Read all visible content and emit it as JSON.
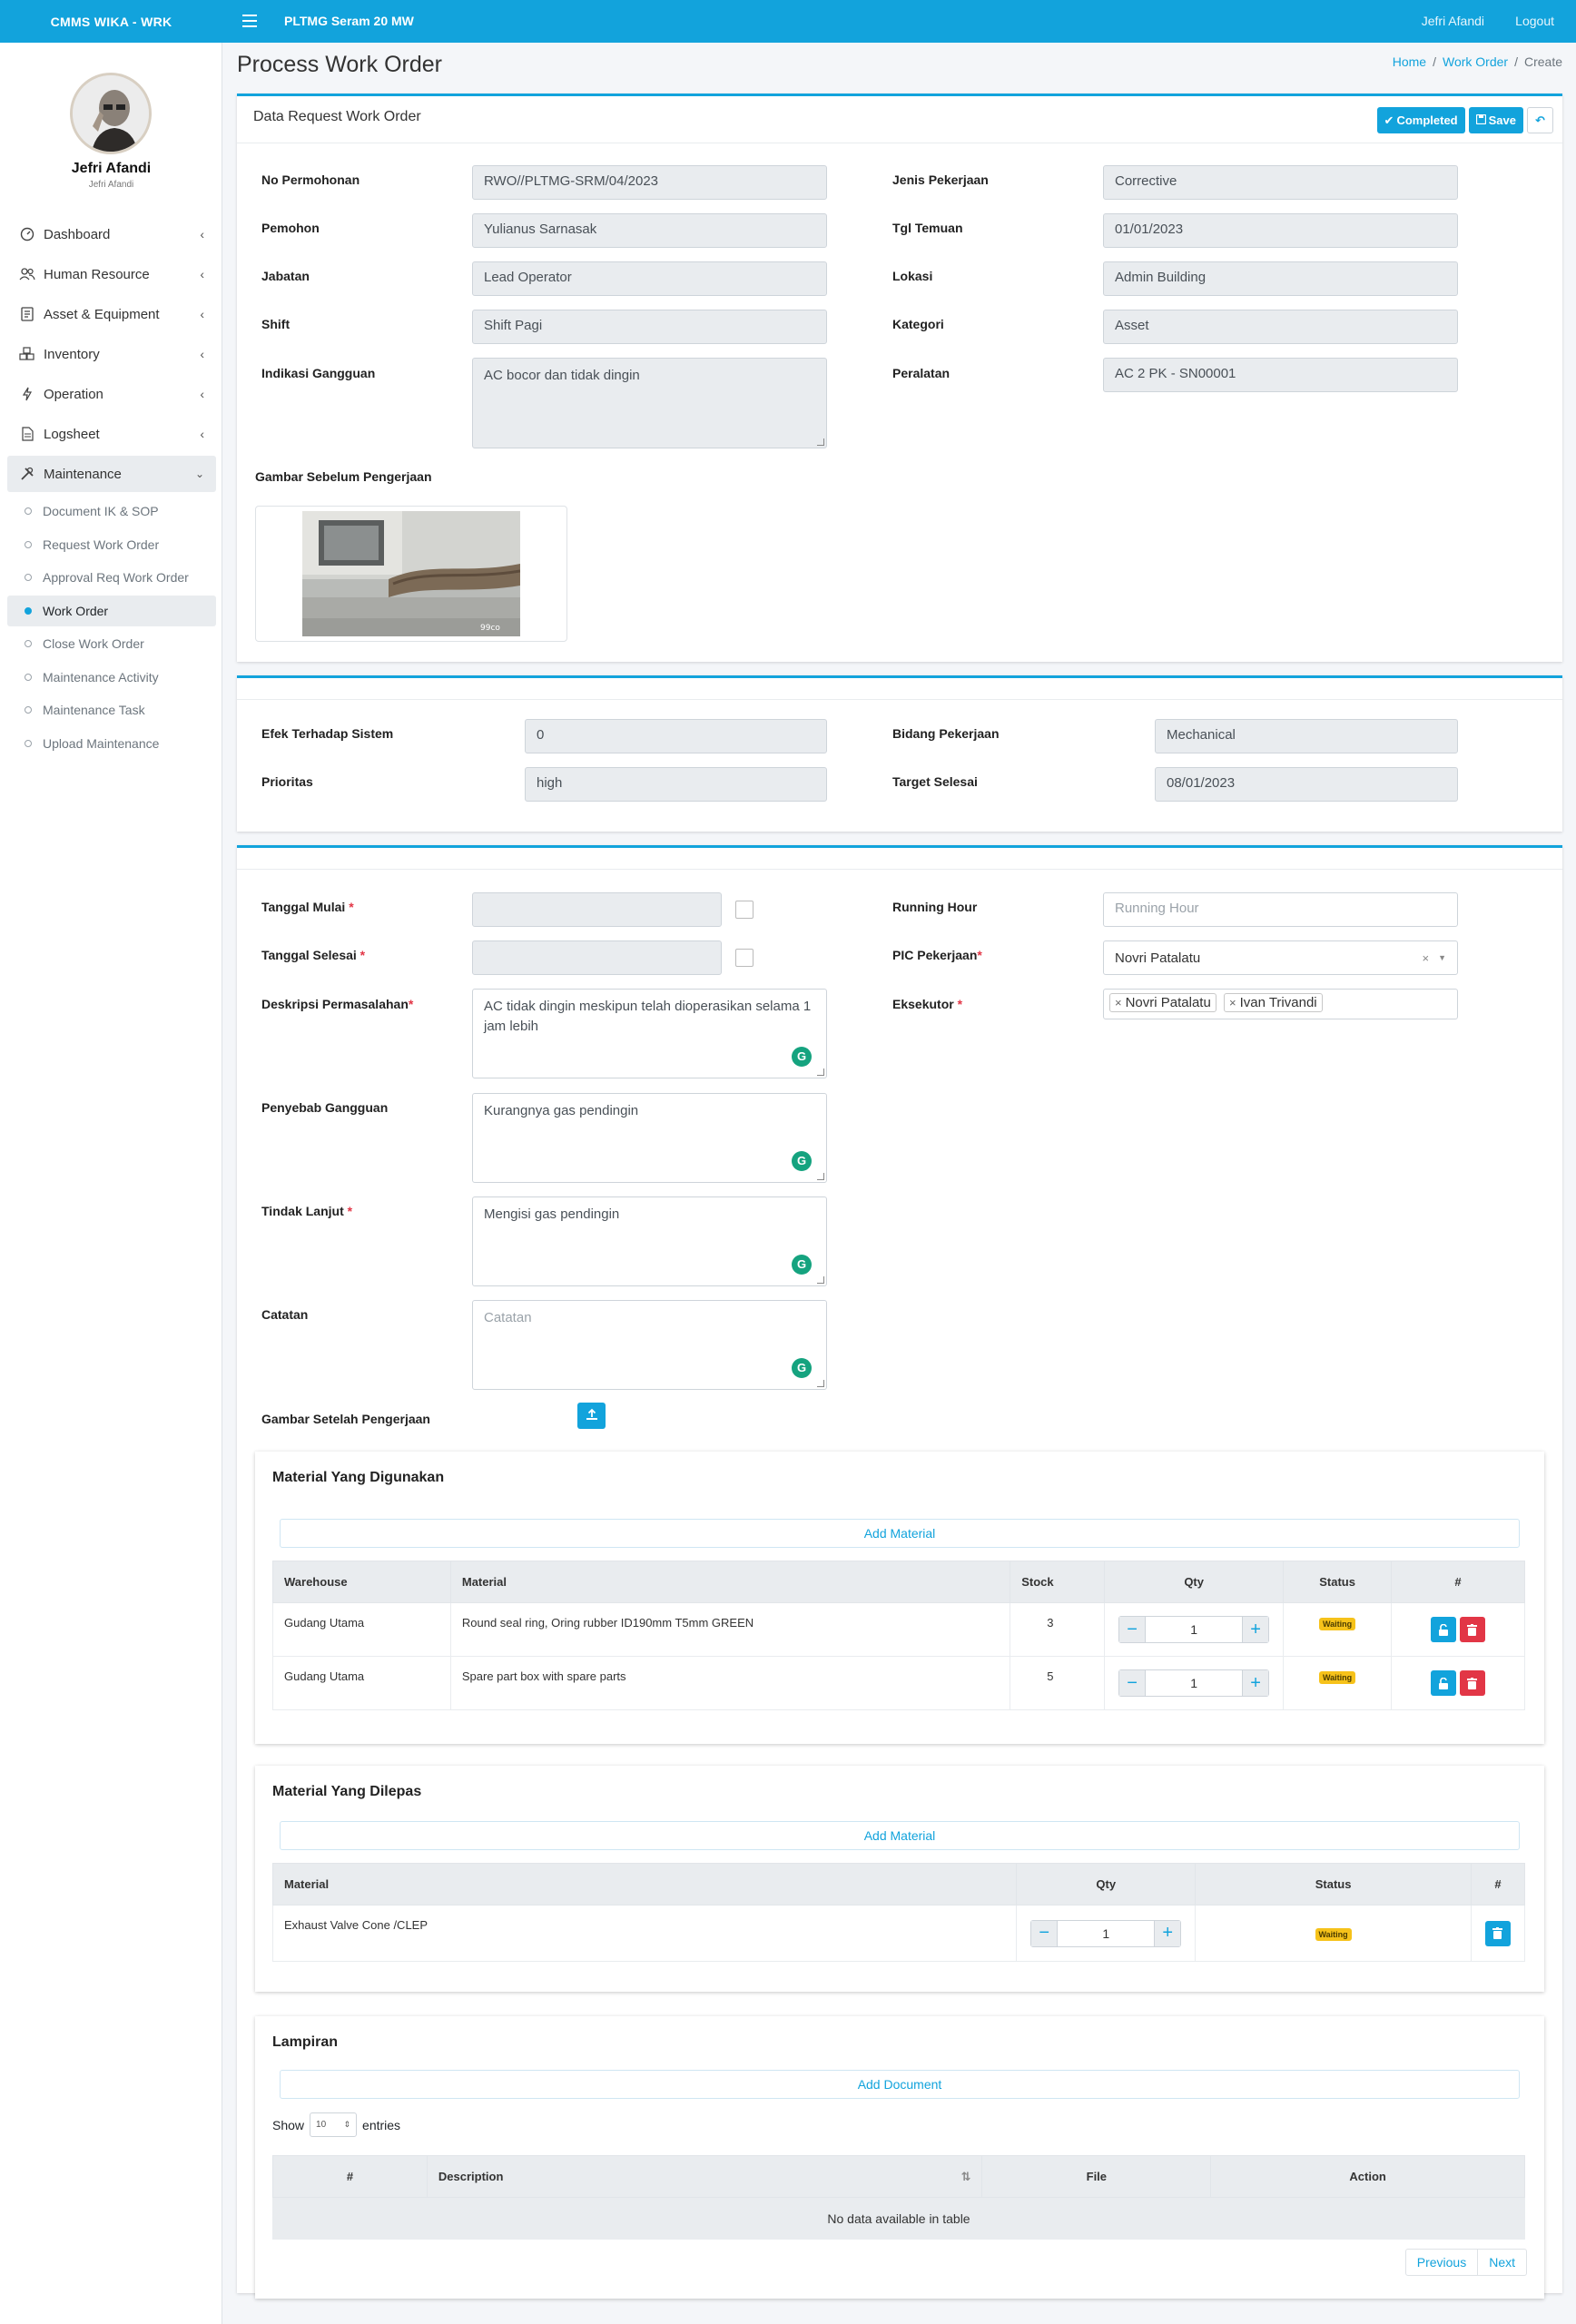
{
  "app": {
    "brand": "CMMS WIKA - WRK",
    "plant": "PLTMG Seram 20 MW",
    "user_link": "Jefri Afandi",
    "logout": "Logout"
  },
  "sidebar": {
    "user_name": "Jefri Afandi",
    "user_sub": "Jefri Afandi",
    "menu": [
      {
        "label": "Dashboard",
        "icon": "dashboard-icon"
      },
      {
        "label": "Human Resource",
        "icon": "users-icon"
      },
      {
        "label": "Asset & Equipment",
        "icon": "clipboard-icon"
      },
      {
        "label": "Inventory",
        "icon": "cubes-icon"
      },
      {
        "label": "Operation",
        "icon": "bolt-icon"
      },
      {
        "label": "Logsheet",
        "icon": "file-icon"
      },
      {
        "label": "Maintenance",
        "icon": "tools-icon"
      }
    ],
    "submenu": [
      "Document IK & SOP",
      "Request Work Order",
      "Approval Req Work Order",
      "Work Order",
      "Close Work Order",
      "Maintenance Activity",
      "Maintenance Task",
      "Upload Maintenance"
    ],
    "active_submenu": "Work Order"
  },
  "page": {
    "title": "Process Work Order",
    "breadcrumb": [
      "Home",
      "Work Order",
      "Create"
    ]
  },
  "request_card": {
    "title": "Data Request Work Order",
    "completed_btn": "Completed",
    "save_btn": "Save",
    "labels": {
      "no_permohonan": "No Permohonan",
      "pemohon": "Pemohon",
      "jabatan": "Jabatan",
      "shift": "Shift",
      "indikasi": "Indikasi Gangguan",
      "jenis": "Jenis Pekerjaan",
      "tgl_temuan": "Tgl Temuan",
      "lokasi": "Lokasi",
      "kategori": "Kategori",
      "peralatan": "Peralatan",
      "gambar_sebelum": "Gambar Sebelum Pengerjaan"
    },
    "values": {
      "no_permohonan": "RWO//PLTMG-SRM/04/2023",
      "pemohon": "Yulianus Sarnasak",
      "jabatan": "Lead Operator",
      "shift": "Shift Pagi",
      "indikasi": "AC bocor dan tidak dingin",
      "jenis": "Corrective",
      "tgl_temuan": "01/01/2023",
      "lokasi": "Admin Building",
      "kategori": "Asset",
      "peralatan": "AC 2 PK - SN00001"
    },
    "photo_watermark": "99co"
  },
  "priority_card": {
    "labels": {
      "efek": "Efek Terhadap Sistem",
      "prioritas": "Prioritas",
      "bidang": "Bidang Pekerjaan",
      "target": "Target Selesai"
    },
    "values": {
      "efek": "0",
      "prioritas": "high",
      "bidang": "Mechanical",
      "target": "08/01/2023"
    }
  },
  "process_card": {
    "labels": {
      "tgl_mulai": "Tanggal Mulai",
      "tgl_selesai": "Tanggal Selesai",
      "deskripsi": "Deskripsi Permasalahan",
      "penyebab": "Penyebab Gangguan",
      "tindak": "Tindak Lanjut",
      "catatan": "Catatan",
      "gambar_setelah": "Gambar Setelah Pengerjaan",
      "running": "Running Hour",
      "pic": "PIC Pekerjaan",
      "eksekutor": "Eksekutor"
    },
    "values": {
      "tgl_mulai": "",
      "tgl_selesai": "",
      "deskripsi": "AC tidak dingin meskipun telah dioperasikan selama 1 jam lebih",
      "penyebab": "Kurangnya gas pendingin",
      "tindak": "Mengisi gas pendingin",
      "catatan": "",
      "running": "",
      "pic": "Novri Patalatu",
      "eksekutor": [
        "Novri Patalatu",
        "Ivan Trivandi"
      ]
    },
    "placeholders": {
      "catatan": "Catatan",
      "running": "Running Hour"
    }
  },
  "material_used": {
    "title": "Material Yang Digunakan",
    "add_label": "Add Material",
    "columns": [
      "Warehouse",
      "Material",
      "Stock",
      "Qty",
      "Status",
      "#"
    ],
    "rows": [
      {
        "warehouse": "Gudang Utama",
        "material": "Round seal ring, Oring rubber ID190mm T5mm GREEN",
        "stock": "3",
        "qty": "1",
        "status": "Waiting"
      },
      {
        "warehouse": "Gudang Utama",
        "material": "Spare part box with spare parts",
        "stock": "5",
        "qty": "1",
        "status": "Waiting"
      }
    ]
  },
  "material_removed": {
    "title": "Material Yang Dilepas",
    "add_label": "Add Material",
    "columns": [
      "Material",
      "Qty",
      "Status",
      "#"
    ],
    "rows": [
      {
        "material": "Exhaust Valve Cone /CLEP",
        "qty": "1",
        "status": "Waiting"
      }
    ]
  },
  "lampiran": {
    "title": "Lampiran",
    "add_label": "Add Document",
    "show_label": "Show",
    "entries_value": "10",
    "entries_label": "entries",
    "columns": [
      "#",
      "Description",
      "File",
      "Action"
    ],
    "empty": "No data available in table",
    "prev": "Previous",
    "next": "Next"
  },
  "colors": {
    "primary": "#12a3dc",
    "danger": "#e23646",
    "warning_badge": "#f6c21a",
    "grammarly": "#15a37f"
  }
}
